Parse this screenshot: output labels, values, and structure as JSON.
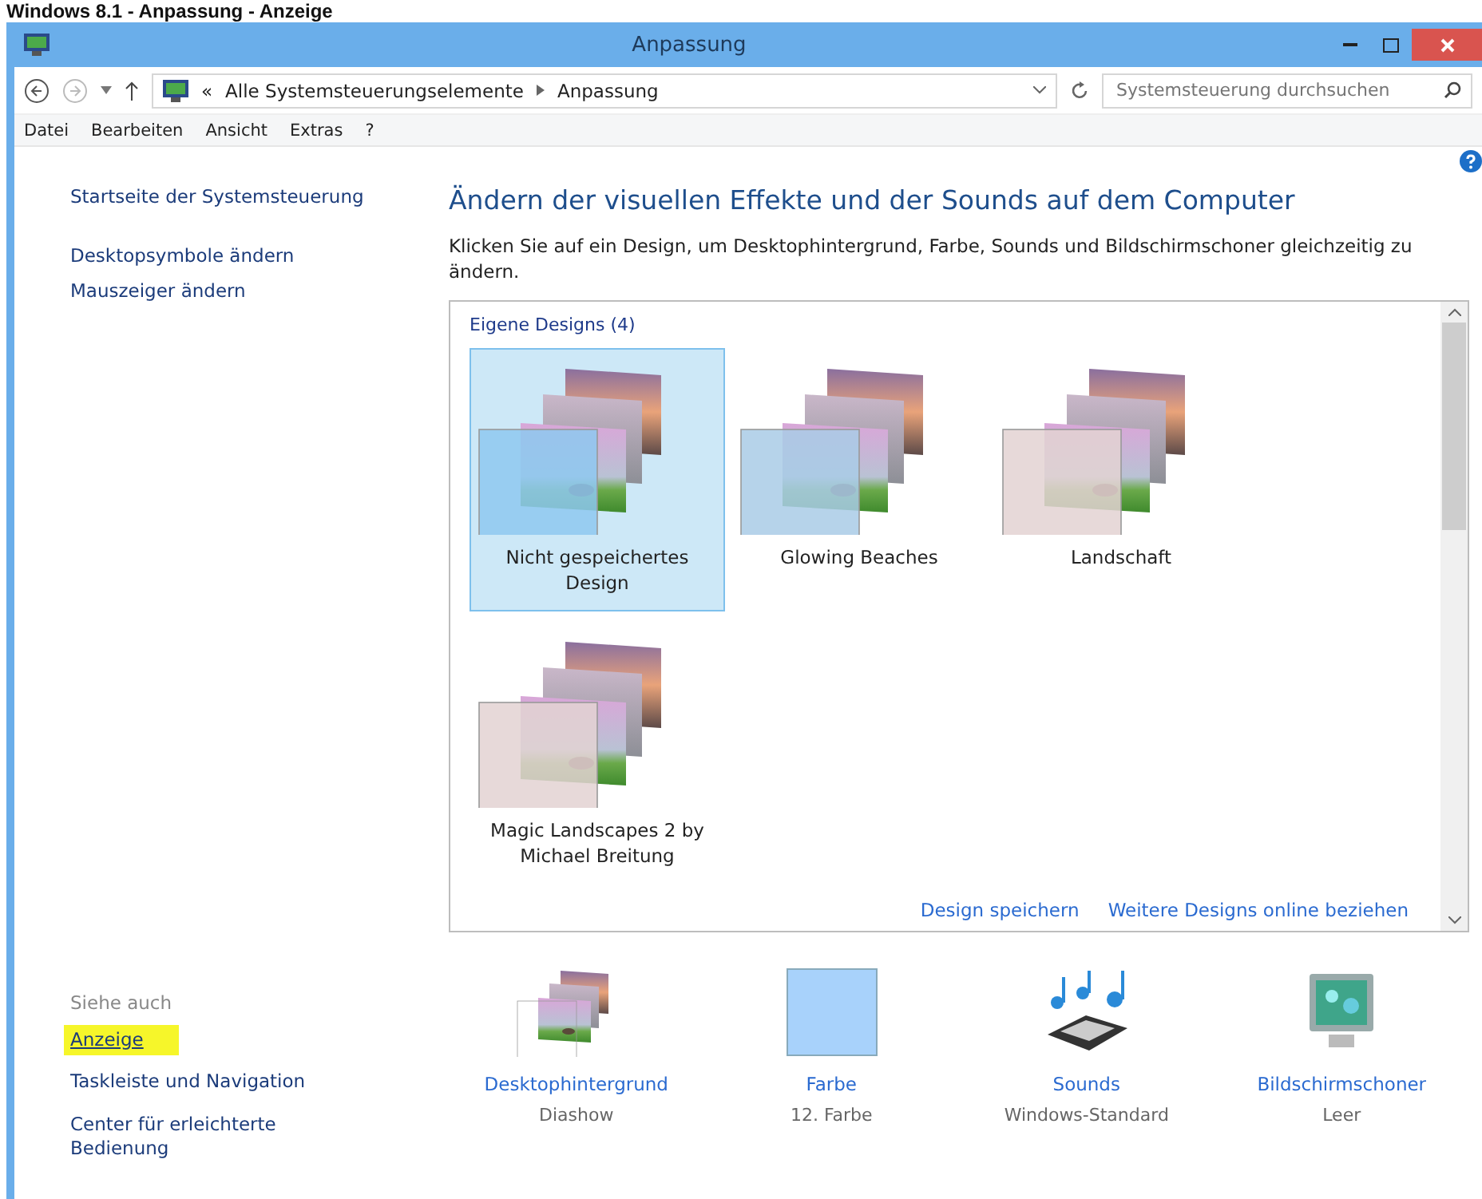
{
  "page_heading": "Windows 8.1 - Anpassung - Anzeige",
  "window": {
    "title": "Anpassung"
  },
  "address_bar": {
    "prefix": "«",
    "path": [
      "Alle Systemsteuerungselemente",
      "Anpassung"
    ],
    "search_placeholder": "Systemsteuerung durchsuchen"
  },
  "menu": [
    "Datei",
    "Bearbeiten",
    "Ansicht",
    "Extras",
    "?"
  ],
  "sidebar": {
    "items": [
      {
        "label": "Startseite der Systemsteuerung"
      },
      {
        "label": "Desktopsymbole ändern"
      },
      {
        "label": "Mauszeiger ändern"
      }
    ],
    "see_also_title": "Siehe auch",
    "see_also": [
      {
        "label": "Anzeige",
        "highlighted": true
      },
      {
        "label": "Taskleiste und Navigation",
        "highlighted": false
      },
      {
        "label": "Center für erleichterte Bedienung",
        "highlighted": false
      }
    ]
  },
  "heading": "Ändern der visuellen Effekte und der Sounds auf dem Computer",
  "description": "Klicken Sie auf ein Design, um Desktophintergrund, Farbe, Sounds und Bildschirmschoner gleichzeitig zu ändern.",
  "designs": {
    "group_title": "Eigene Designs (4)",
    "items": [
      {
        "name": "Nicht gespeichertes Design",
        "selected": true,
        "color": "#8ec8f0"
      },
      {
        "name": "Glowing Beaches",
        "selected": false,
        "color": "#a9cbe6"
      },
      {
        "name": "Landschaft",
        "selected": false,
        "color": "#e3d2d2"
      },
      {
        "name": "Magic Landscapes 2 by Michael Breitung",
        "selected": false,
        "color": "#e3d2d2"
      }
    ],
    "links": [
      "Design speichern",
      "Weitere Designs online beziehen"
    ]
  },
  "settings": [
    {
      "kind": "background",
      "label": "Desktophintergrund",
      "value": "Diashow"
    },
    {
      "kind": "color",
      "label": "Farbe",
      "value": "12. Farbe"
    },
    {
      "kind": "sounds",
      "label": "Sounds",
      "value": "Windows-Standard"
    },
    {
      "kind": "screensaver",
      "label": "Bildschirmschoner",
      "value": "Leer"
    }
  ]
}
